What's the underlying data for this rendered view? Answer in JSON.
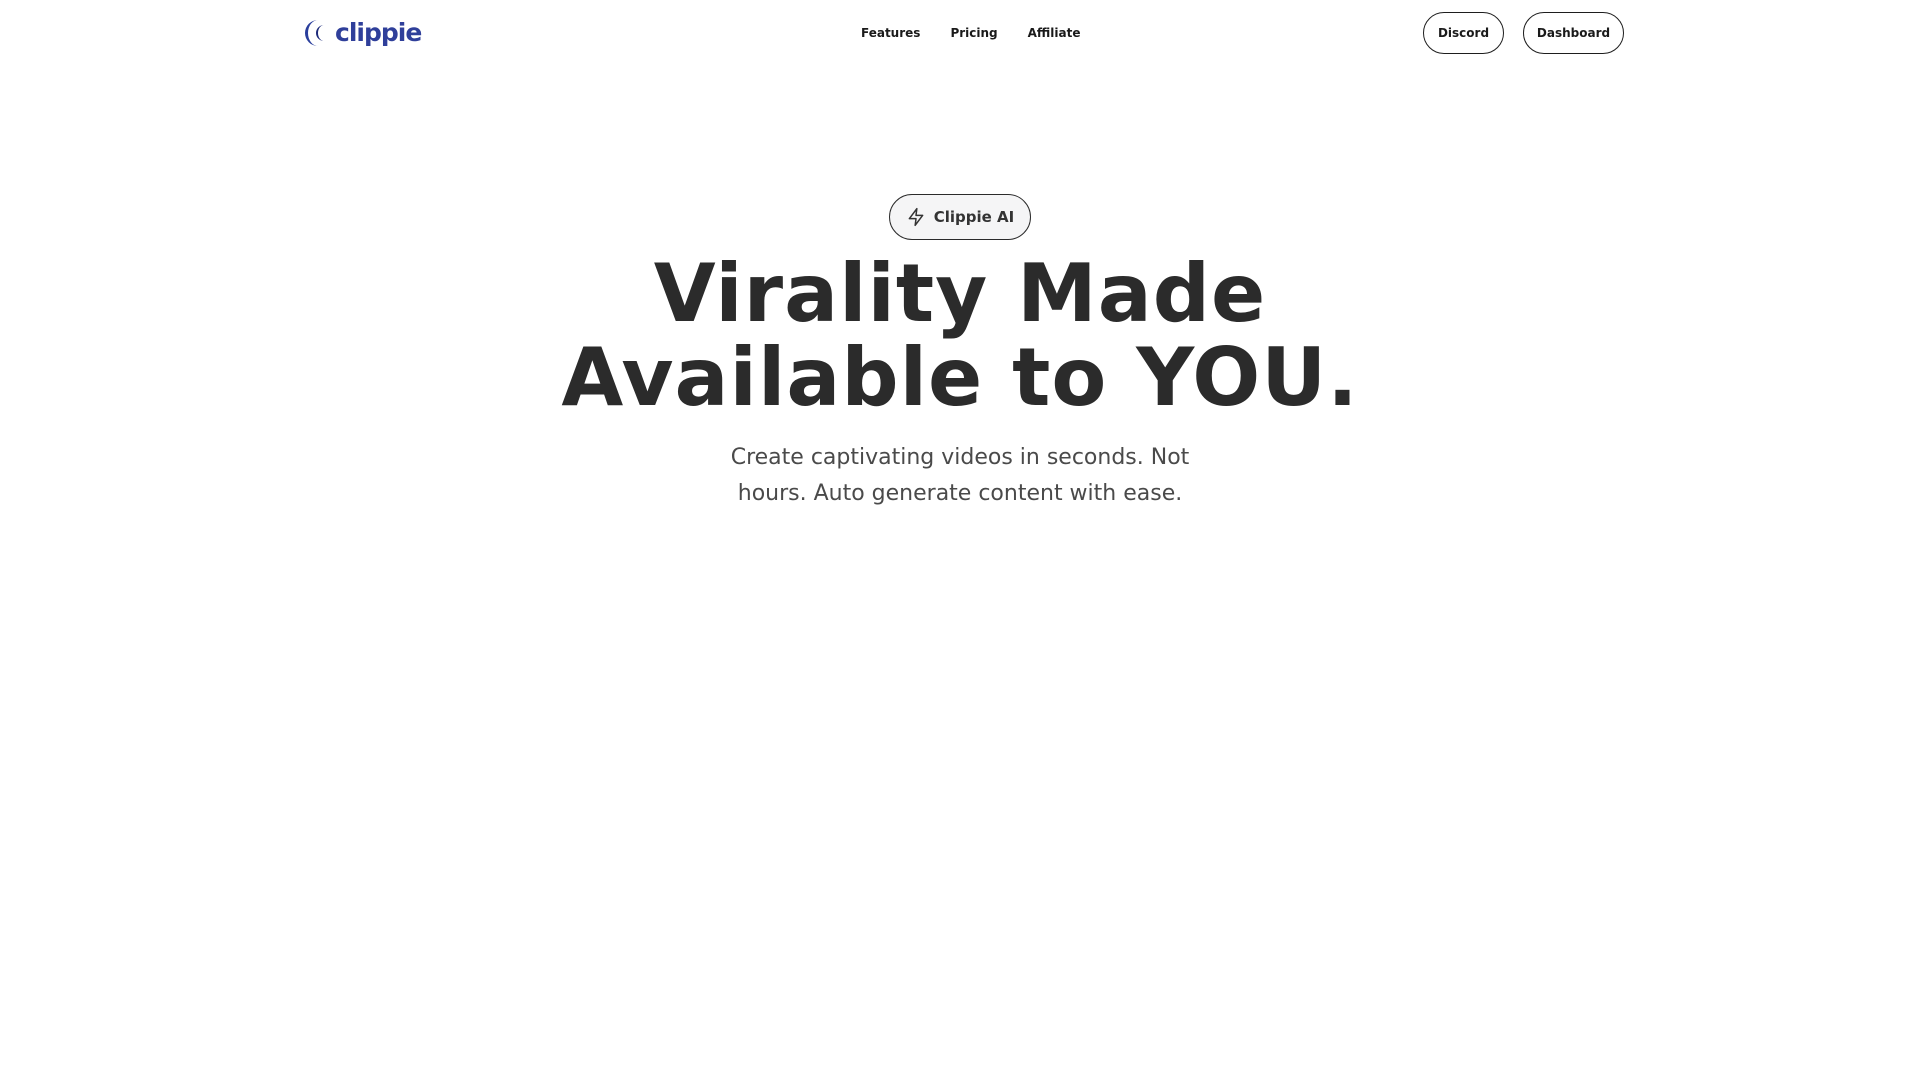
{
  "brand": {
    "name": "clippie",
    "color": "#2f3f9a",
    "logo_icon": "crescent-logo-icon"
  },
  "nav": {
    "items": [
      {
        "label": "Features"
      },
      {
        "label": "Pricing"
      },
      {
        "label": "Affiliate"
      }
    ]
  },
  "header_actions": {
    "discord_label": "Discord",
    "dashboard_label": "Dashboard"
  },
  "hero": {
    "badge": {
      "icon": "lightning-icon",
      "label": "Clippie AI"
    },
    "headline_lines": [
      "Virality Made",
      "Available to YOU."
    ],
    "subtitle_lines": [
      "Create captivating videos in seconds. Not",
      "hours. Auto generate content with ease."
    ]
  },
  "colors": {
    "text_dark": "#2b2b2b",
    "badge_bg": "#f5f5f6",
    "background": "#ffffff"
  }
}
